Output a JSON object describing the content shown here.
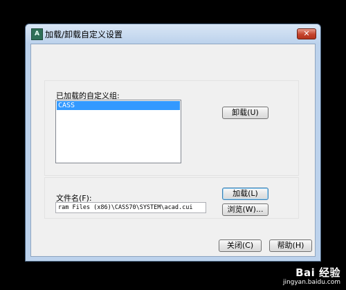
{
  "window": {
    "title": "加载/卸载自定义设置",
    "icon": "cad-app-icon",
    "close_glyph": "✕"
  },
  "loaded_groups": {
    "label": "已加载的自定义组:",
    "items": [
      "CASS"
    ],
    "selected_index": 0
  },
  "buttons": {
    "unload": "卸载(U)",
    "load": "加载(L)",
    "browse": "浏览(W)...",
    "close": "关闭(C)",
    "help": "帮助(H)"
  },
  "file": {
    "label": "文件名(F):",
    "value": "ram Files (x86)\\CASS70\\SYSTEM\\acad.cui"
  },
  "watermark": {
    "brand": "Bai 经验",
    "url": "jingyan.baidu.com"
  }
}
